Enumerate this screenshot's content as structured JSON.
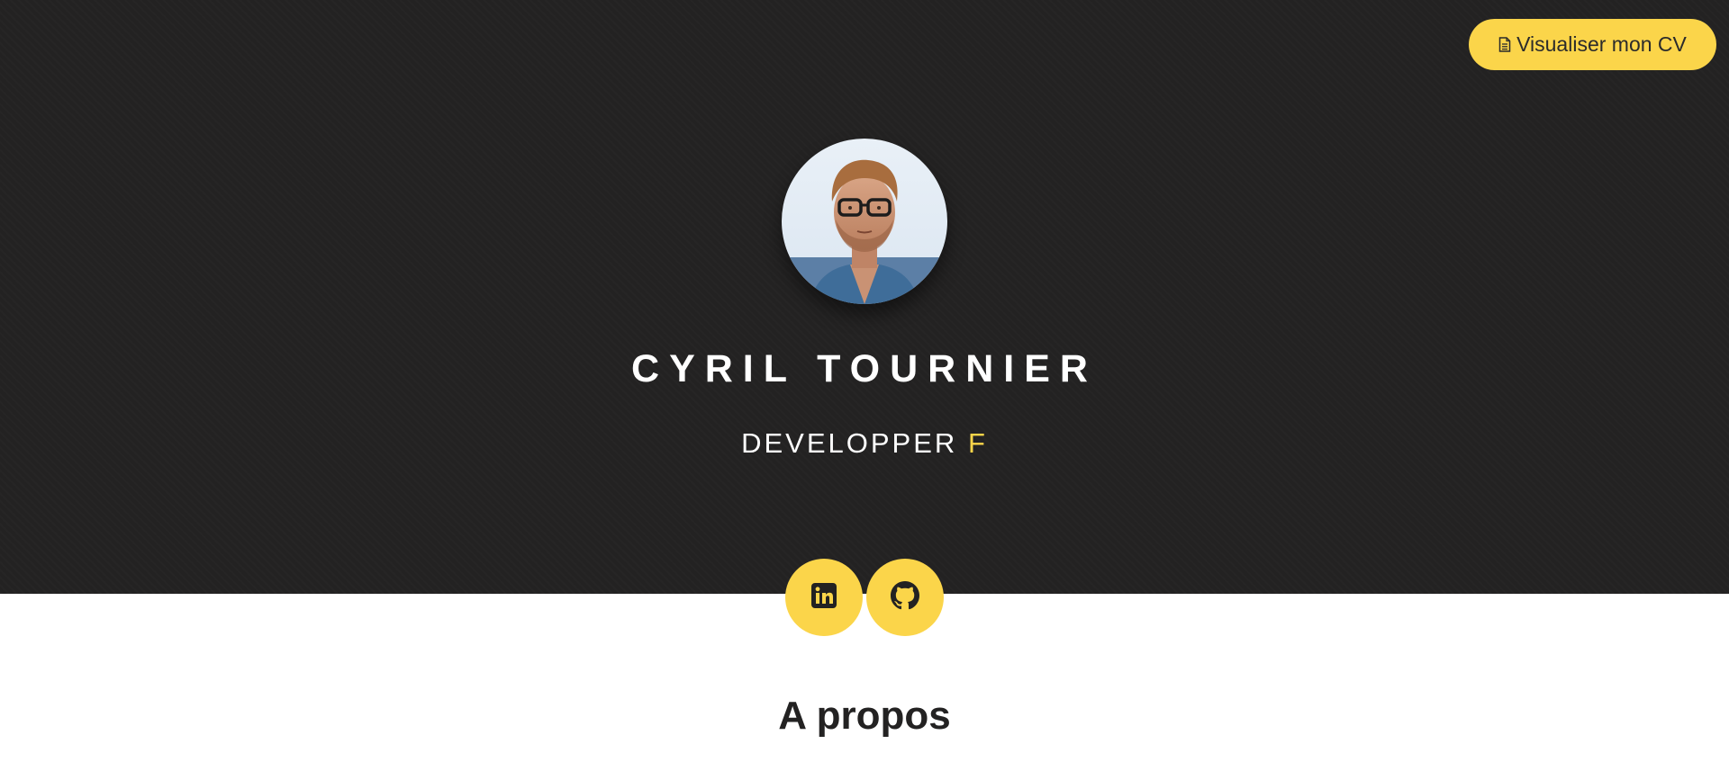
{
  "header": {
    "cv_button_label": "Visualiser mon CV",
    "cv_icon": "document-icon"
  },
  "profile": {
    "name": "CYRIL TOURNIER",
    "role_prefix": "DEVELOPPER",
    "role_typed": "F",
    "avatar_icon": "profile-photo"
  },
  "social": {
    "linkedin_icon": "linkedin-icon",
    "github_icon": "github-icon"
  },
  "about": {
    "title": "A propos"
  },
  "colors": {
    "hero_background": "#232222",
    "accent": "#fbd54a",
    "page_background": "#ffffff"
  }
}
